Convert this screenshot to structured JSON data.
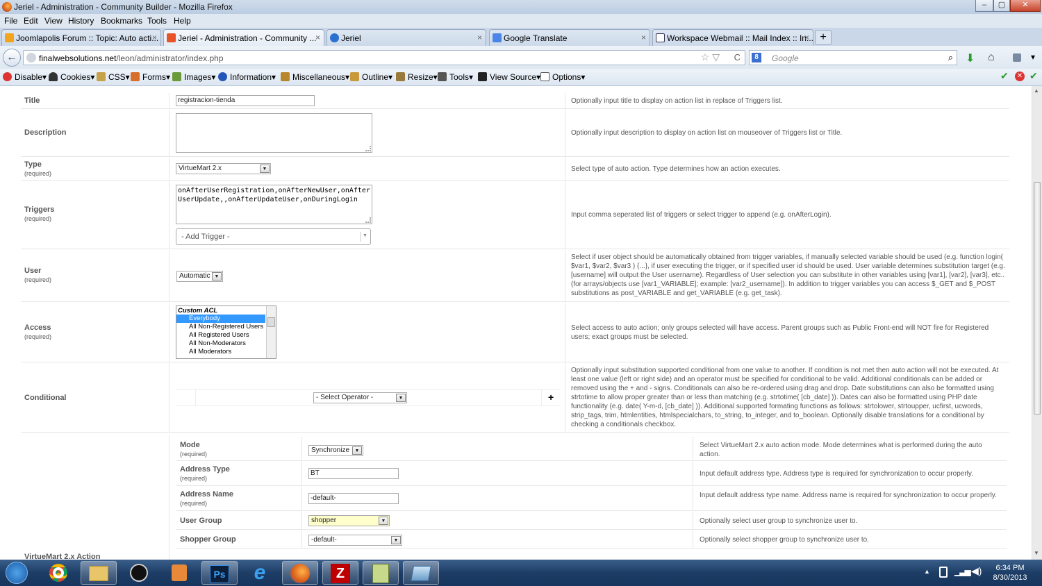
{
  "window": {
    "title": "Jeriel - Administration - Community Builder - Mozilla Firefox",
    "controls": [
      "–",
      "▢",
      "✕"
    ]
  },
  "menu": [
    "File",
    "Edit",
    "View",
    "History",
    "Bookmarks",
    "Tools",
    "Help"
  ],
  "tabs": [
    {
      "label": "Joomlapolis Forum :: Topic: Auto acti...",
      "close": "×",
      "icon": "joomla-icon"
    },
    {
      "label": "Jeriel - Administration - Community ...",
      "close": "×",
      "icon": "joomla-icon"
    },
    {
      "label": "Jeriel",
      "close": "×",
      "icon": "globe-icon"
    },
    {
      "label": "Google Translate",
      "close": "×",
      "icon": "translate-icon"
    },
    {
      "label": "Workspace Webmail :: Mail Index :: In...",
      "close": "×",
      "icon": "mail-icon"
    }
  ],
  "new_tab": "+",
  "nav": {
    "back": "←",
    "url_domain": "finalwebsolutions.net",
    "url_path": "/leon/administrator/index.php",
    "star": "☆ ▽",
    "reload": "C",
    "search_engine": "8",
    "search_placeholder": "Google",
    "search_icon": "⌕",
    "download": "⬇",
    "home": "⌂",
    "menu": "▾"
  },
  "devbar": [
    "Disable▾",
    "Cookies▾",
    "CSS▾",
    "Forms▾",
    "Images▾",
    "Information▾",
    "Miscellaneous▾",
    "Outline▾",
    "Resize▾",
    "Tools▾",
    "View Source▾",
    "Options▾"
  ],
  "form": {
    "title": {
      "label": "Title",
      "value": "registracion-tienda",
      "desc": "Optionally input title to display on action list in replace of Triggers list."
    },
    "description": {
      "label": "Description",
      "desc": "Optionally input description to display on action list on mouseover of Triggers list or Title."
    },
    "type": {
      "label": "Type",
      "req": "(required)",
      "value": "VirtueMart 2.x",
      "desc": "Select type of auto action. Type determines how an action executes."
    },
    "triggers": {
      "label": "Triggers",
      "req": "(required)",
      "value": "onAfterUserRegistration,onAfterNewUser,onAfterUserUpdate,,onAfterUpdateUser,onDuringLogin",
      "add": "- Add Trigger -",
      "desc": "Input comma seperated list of triggers or select trigger to append (e.g. onAfterLogin)."
    },
    "user": {
      "label": "User",
      "req": "(required)",
      "value": "Automatic",
      "desc": "Select if user object should be automatically obtained from trigger variables, if manually selected variable should be used (e.g. function login( $var1, $var2, $var3 ) {...}, if user executing the trigger, or if specified user id should be used. User variable determines substitution target (e.g. [username] will output the User username). Regardless of User selection you can substitute in other variables using [var1], [var2], [var3], etc.. (for arrays/objects use [var1_VARIABLE]; example: [var2_username]). In addition to trigger variables you can access $_GET and $_POST substitutions as post_VARIABLE and get_VARIABLE (e.g. get_task)."
    },
    "access": {
      "label": "Access",
      "req": "(required)",
      "group": "Custom ACL",
      "options": [
        "Everybody",
        "All Non-Registered Users",
        "All Registered Users",
        "All Non-Moderators",
        "All Moderators"
      ],
      "desc": "Select access to auto action; only groups selected will have access. Parent groups such as Public Front-end will NOT fire for Registered users; exact groups must be selected."
    },
    "conditional": {
      "label": "Conditional",
      "operator": "- Select Operator -",
      "add": "+",
      "desc": "Optionally input substitution supported conditional from one value to another. If condition is not met then auto action will not be executed. At least one value (left or right side) and an operator must be specified for conditional to be valid. Additional conditionals can be added or removed using the + and - signs. Conditionals can also be re-ordered using drag and drop. Date substitutions can also be formatted using strtotime to allow proper greater than or less than matching (e.g. strtotime( [cb_date] )). Dates can also be formatted using PHP date functionality (e.g. date( Y-m-d, [cb_date] )). Additional supported formating functions as follows: strtolower, strtoupper, ucfirst, ucwords, strip_tags, trim, htmlentities, htmlspecialchars, to_string, to_integer, and to_boolean. Optionally disable translations for a conditional by checking a conditionals checkbox."
    },
    "vm_label": "VirtueMart 2.x Action",
    "mode": {
      "label": "Mode",
      "req": "(required)",
      "value": "Synchronize",
      "desc": "Select VirtueMart 2.x auto action mode. Mode determines what is performed during the auto action."
    },
    "address_type": {
      "label": "Address Type",
      "req": "(required)",
      "value": "BT",
      "desc": "Input default address type. Address type is required for synchronization to occur properly."
    },
    "address_name": {
      "label": "Address Name",
      "req": "(required)",
      "value": "-default-",
      "desc": "Input default address type name. Address name is required for synchronization to occur properly."
    },
    "user_group": {
      "label": "User Group",
      "value": "shopper",
      "desc": "Optionally select user group to synchronize user to."
    },
    "shopper_group": {
      "label": "Shopper Group",
      "value": "-default-",
      "desc": "Optionally select shopper group to synchronize user to."
    }
  },
  "taskbar": {
    "apps": [
      "start-orb",
      "chrome",
      "explorer",
      "hp",
      "media",
      "photoshop",
      "ie",
      "firefox",
      "filezilla",
      "notepad",
      "app"
    ],
    "ps_label": "Ps",
    "time": "6:34 PM",
    "date": "8/30/2013"
  }
}
